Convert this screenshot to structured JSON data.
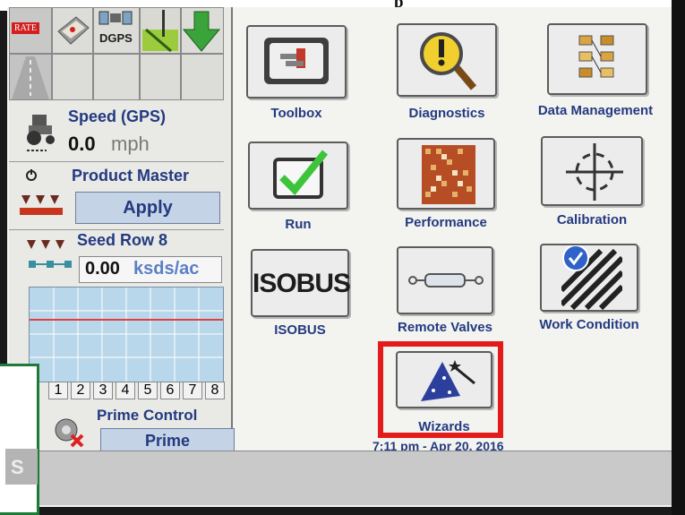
{
  "header": {
    "partial_text": "p"
  },
  "left_panel": {
    "top_icons": {
      "rate": "RATE",
      "dgps": "DGPS"
    },
    "speed": {
      "label": "Speed (GPS)",
      "value": "0.0",
      "unit": "mph"
    },
    "product_master": {
      "label": "Product Master",
      "button": "Apply"
    },
    "seed_row": {
      "label": "Seed Row 8",
      "value": "0.00",
      "unit": "ksds/ac"
    },
    "row_numbers": [
      "1",
      "2",
      "3",
      "4",
      "5",
      "6",
      "7",
      "8"
    ],
    "prime_control": {
      "label": "Prime Control",
      "button": "Prime"
    }
  },
  "apps": [
    {
      "name": "toolbox",
      "label": "Toolbox"
    },
    {
      "name": "diagnostics",
      "label": "Diagnostics"
    },
    {
      "name": "data-management",
      "label": "Data Management"
    },
    {
      "name": "run",
      "label": "Run"
    },
    {
      "name": "performance",
      "label": "Performance"
    },
    {
      "name": "calibration",
      "label": "Calibration"
    },
    {
      "name": "isobus",
      "label": "ISOBUS",
      "icon_text": "ISOBUS"
    },
    {
      "name": "remote-valves",
      "label": "Remote Valves"
    },
    {
      "name": "work-condition",
      "label": "Work Condition"
    },
    {
      "name": "wizards",
      "label": "Wizards"
    }
  ],
  "datetime": "7:11 pm - Apr 20, 2016",
  "overlay": {
    "text": "S"
  },
  "colors": {
    "label_blue": "#233a80",
    "highlight_red": "#e31b1b",
    "check_green": "#3cc43a",
    "overlay_green": "#1e7a37"
  }
}
